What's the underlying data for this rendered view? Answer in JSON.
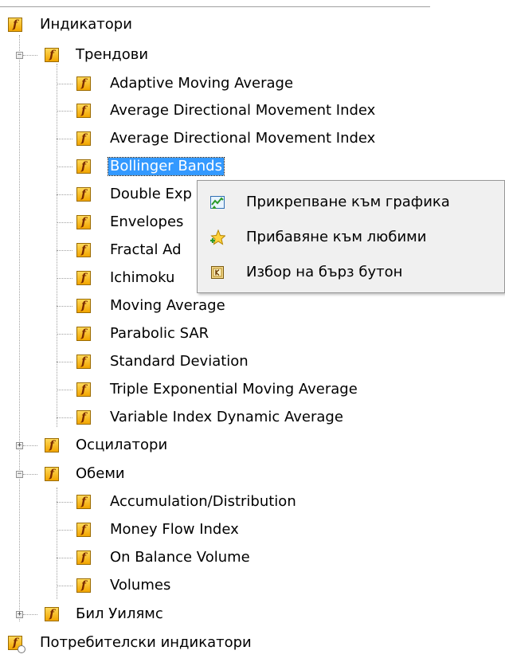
{
  "tree": {
    "root": {
      "label": "Индикатори",
      "icon": "fx-icon"
    },
    "groups": [
      {
        "label": "Трендови",
        "expanded": true,
        "expander": "−",
        "items": [
          "Adaptive Moving Average",
          "Average Directional Movement Index",
          "Average Directional Movement Index",
          "Bollinger Bands",
          "Double Exp",
          "Envelopes",
          "Fractal Ad",
          "Ichimoku",
          "Moving Average",
          "Parabolic SAR",
          "Standard Deviation",
          "Triple Exponential Moving Average",
          "Variable Index Dynamic Average"
        ],
        "selected_index": 3
      },
      {
        "label": "Осцилатори",
        "expanded": false,
        "expander": "+",
        "items": []
      },
      {
        "label": "Обеми",
        "expanded": true,
        "expander": "−",
        "items": [
          "Accumulation/Distribution",
          "Money Flow Index",
          "On Balance Volume",
          "Volumes"
        ]
      },
      {
        "label": "Бил Уилямс",
        "expanded": false,
        "expander": "+",
        "items": []
      }
    ],
    "custom": {
      "label": "Потребителски индикатори",
      "icon": "fx-custom-icon"
    }
  },
  "context_menu": {
    "items": [
      {
        "label": "Прикрепване към графика",
        "icon": "attach-chart-icon"
      },
      {
        "label": "Прибавяне към любими",
        "icon": "favorite-star-icon"
      },
      {
        "label": "Избор на бърз бутон",
        "icon": "hotkey-icon"
      }
    ]
  },
  "colors": {
    "selection": "#3399ff",
    "menu_bg": "#f0f0f0",
    "fx_icon": "#f2a500"
  }
}
